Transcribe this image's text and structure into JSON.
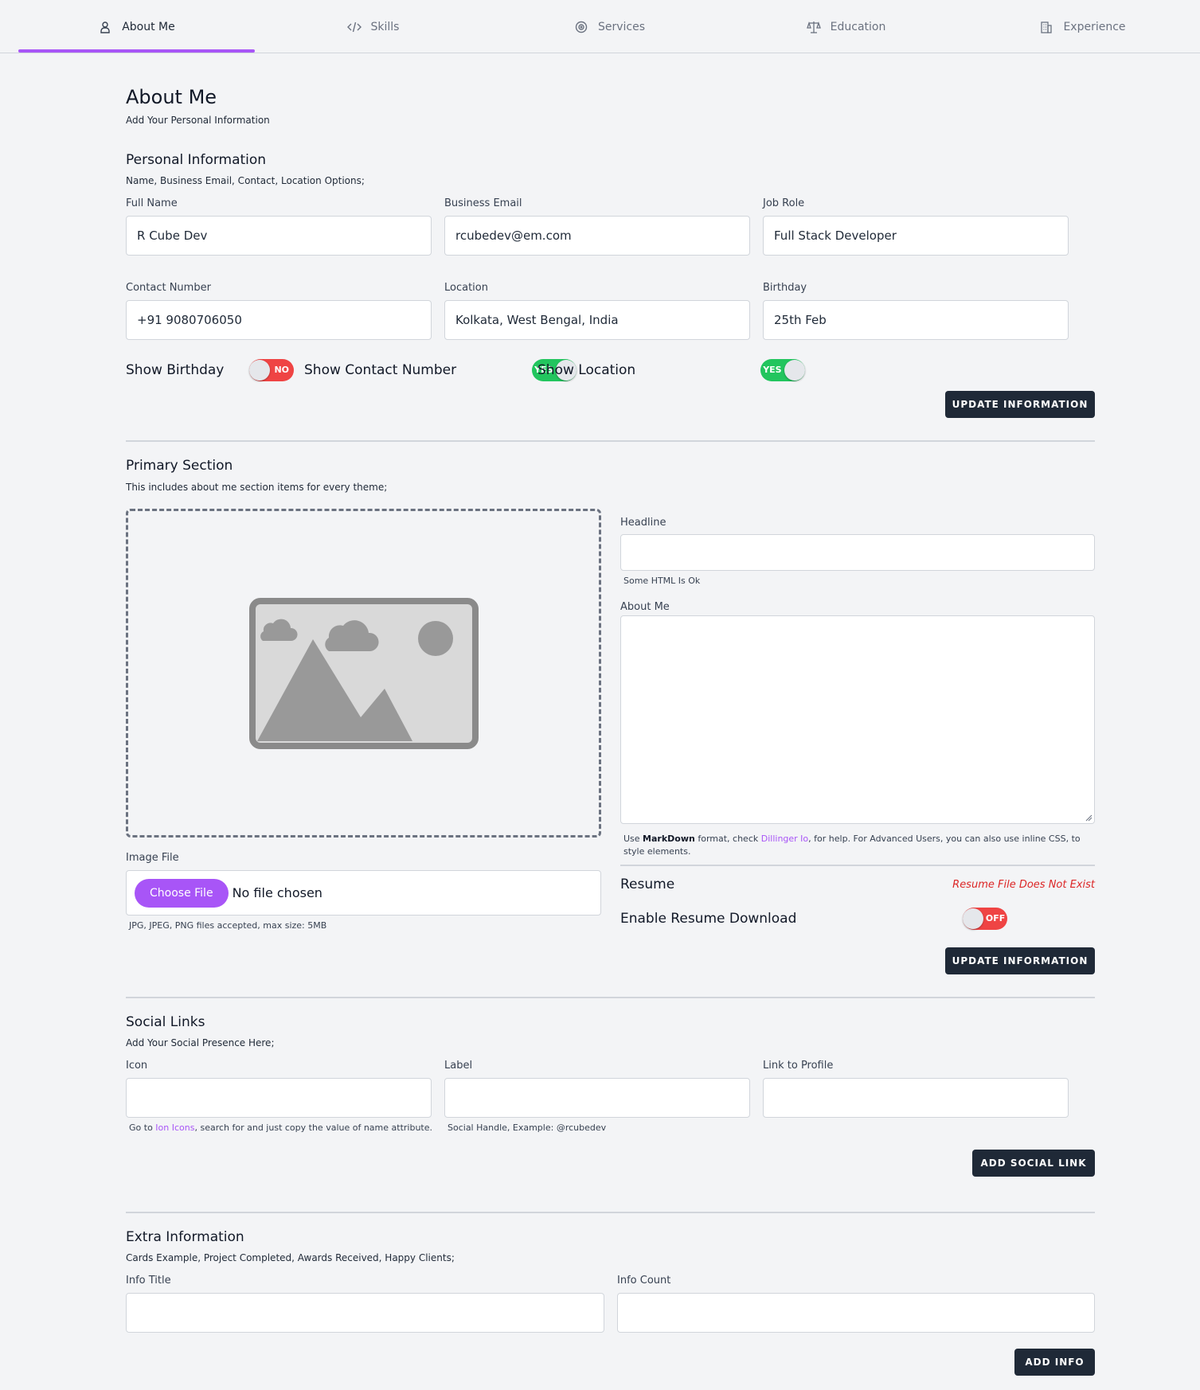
{
  "tabs": [
    {
      "label": "About Me",
      "icon": "user-icon",
      "active": true
    },
    {
      "label": "Skills",
      "icon": "code-icon"
    },
    {
      "label": "Services",
      "icon": "target-icon"
    },
    {
      "label": "Education",
      "icon": "scale-icon"
    },
    {
      "label": "Experience",
      "icon": "building-icon"
    }
  ],
  "header": {
    "title": "About Me",
    "subtitle": "Add Your Personal Information"
  },
  "personal": {
    "title": "Personal Information",
    "subtitle": "Name, Business Email, Contact, Location Options;",
    "fields": {
      "full_name": {
        "label": "Full Name",
        "value": "R Cube Dev"
      },
      "email": {
        "label": "Business Email",
        "value": "rcubedev@em.com"
      },
      "job_role": {
        "label": "Job Role",
        "value": "Full Stack Developer"
      },
      "contact": {
        "label": "Contact Number",
        "value": "+91 9080706050"
      },
      "location": {
        "label": "Location",
        "value": "Kolkata, West Bengal, India"
      },
      "birthday": {
        "label": "Birthday",
        "value": "25th Feb"
      }
    },
    "toggles": {
      "birthday": {
        "label": "Show Birthday",
        "state": "NO"
      },
      "contact": {
        "label": "Show Contact Number",
        "state": "YES"
      },
      "location": {
        "label": "Show Location",
        "state": "YES"
      }
    },
    "update_label": "UPDATE INFORMATION"
  },
  "primary": {
    "title": "Primary Section",
    "subtitle": "This includes about me section items for every theme;",
    "image_file_label": "Image File",
    "choose_file": "Choose File",
    "no_file": "No file chosen",
    "file_hint": "JPG, JPEG, PNG files accepted, max size: 5MB",
    "headline_label": "Headline",
    "headline_value": "",
    "headline_hint": "Some HTML Is Ok",
    "about_label": "About Me",
    "about_value": "",
    "about_hint": {
      "pre": "Use ",
      "bold": "MarkDown",
      "mid": " format, check ",
      "link": "Dillinger Io",
      "post": ", for help. For Advanced Users, you can also use inline CSS, to style elements."
    },
    "resume_label": "Resume",
    "resume_status": "Resume File Does Not Exist",
    "resume_toggle": {
      "label": "Enable Resume Download",
      "state": "OFF"
    },
    "update_label": "UPDATE INFORMATION"
  },
  "social": {
    "title": "Social Links",
    "subtitle": "Add Your Social Presence Here;",
    "icon_label": "Icon",
    "label_label": "Label",
    "link_label": "Link to Profile",
    "icon_hint": {
      "pre": "Go to ",
      "link": "Ion Icons",
      "post": ", search for and just copy the value of name attribute."
    },
    "label_hint": "Social Handle, Example: @rcubedev",
    "add_label": "ADD SOCIAL LINK"
  },
  "extra": {
    "title": "Extra Information",
    "subtitle": "Cards Example, Project Completed, Awards Received, Happy Clients;",
    "info_title_label": "Info Title",
    "info_count_label": "Info Count",
    "add_label": "ADD INFO"
  },
  "colors": {
    "accent": "#a855f7",
    "button": "#1f2937",
    "toggle_on": "#22c55e",
    "toggle_off": "#ef4444",
    "error": "#dc2626"
  }
}
